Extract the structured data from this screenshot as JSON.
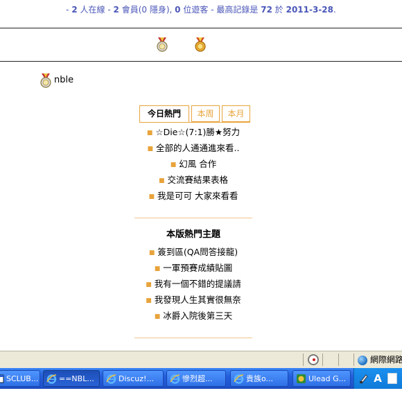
{
  "online_stats": {
    "sep": "-",
    "members_total": "2",
    "members_total_suffix": "人在線",
    "members": "2",
    "members_label": "會員(0 隱身),",
    "guests": "0",
    "guests_label": "位遊客",
    "record_label": "最高記錄是",
    "record_count": "72",
    "record_on": "於",
    "record_date": "2011-3-28",
    "end": "."
  },
  "user": {
    "name": "nble"
  },
  "tabs": [
    {
      "label": "今日熱門",
      "active": true
    },
    {
      "label": "本周",
      "active": false
    },
    {
      "label": "本月",
      "active": false
    }
  ],
  "today_list": [
    "☆Die☆(7:1)勝★努力",
    "全部的人通通進來看..",
    "幻風 合作",
    "交流賽結果表格",
    "我是可可 大家來看看"
  ],
  "section_title": "本版熱門主題",
  "hot_list": [
    "簽到區(QA問答接龍)",
    "一軍預賽成績貼圖",
    "我有一個不錯的提議請",
    "我發現人生其實很無奈",
    "冰爵入院後第三天"
  ],
  "statusbar": {
    "zone": "網際網路"
  },
  "taskbar": {
    "tasks": [
      {
        "label": "SCLUB...",
        "icon": "window-icon"
      },
      {
        "label": "==NBL...",
        "icon": "ie-icon"
      },
      {
        "label": "Discuz!...",
        "icon": "ie-icon"
      },
      {
        "label": "慘烈超...",
        "icon": "ie-icon"
      },
      {
        "label": "貴族o...",
        "icon": "ie-icon"
      },
      {
        "label": "Ulead G...",
        "icon": "ulead-icon"
      }
    ],
    "lang": "A"
  },
  "colors": {
    "accent": "#e8a33b",
    "stats_text": "#4a56b8",
    "taskbar": "#245edb"
  }
}
